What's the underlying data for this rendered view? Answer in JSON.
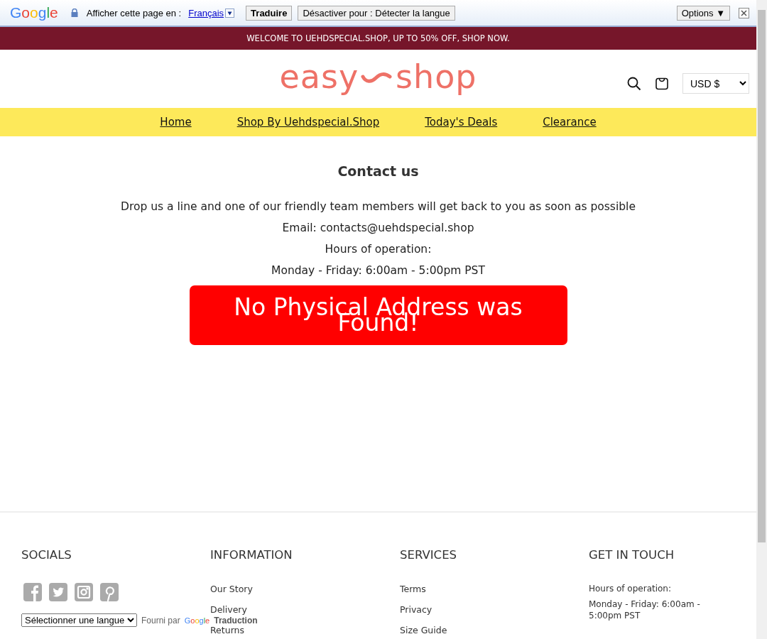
{
  "translate_bar": {
    "brand": "Google",
    "prompt": "Afficher cette page en :",
    "language": "Français",
    "translate_button": "Traduire",
    "disable_button": "Désactiver pour : Détecter la langue",
    "options_button": "Options ▼"
  },
  "announcement": "WELCOME TO UEHDSPECIAL.SHOP, UP TO 50% OFF, SHOP NOW.",
  "header": {
    "logo_left": "easy",
    "logo_right": "shop",
    "currency": "USD $"
  },
  "nav": [
    "Home",
    "Shop By Uehdspecial.Shop",
    "Today's Deals",
    "Clearance"
  ],
  "content": {
    "title": "Contact us",
    "lines": [
      "Drop us a line and one of our friendly team members will get back to you as soon as possible",
      "Email: contacts@uehdspecial.shop",
      "Hours of operation:",
      "Monday - Friday: 6:00am - 5:00pm PST"
    ],
    "alert": "No Physical Address was Found!"
  },
  "footer": {
    "columns": [
      {
        "kind": "socials",
        "heading": "SOCIALS",
        "language_select": "Sélectionner une langue",
        "powered_by": "Fourni par",
        "powered_brand": "Google",
        "powered_product": "Traduction"
      },
      {
        "kind": "links",
        "heading": "INFORMATION",
        "items": [
          "Our Story",
          "Delivery",
          "Returns"
        ]
      },
      {
        "kind": "links",
        "heading": "SERVICES",
        "items": [
          "Terms",
          "Privacy",
          "Size Guide"
        ]
      },
      {
        "kind": "text",
        "heading": "GET IN TOUCH",
        "items": [
          "Hours of operation:",
          "Monday - Friday: 6:00am - 5:00pm PST"
        ]
      }
    ]
  }
}
